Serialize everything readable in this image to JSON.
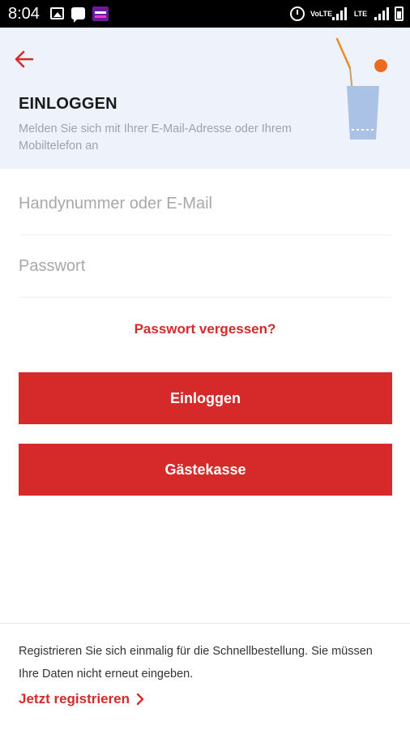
{
  "status_bar": {
    "time": "8:04",
    "lte_label_1": "VoLTE",
    "lte_label_2": "LTE",
    "icons": [
      "gallery-icon",
      "message-icon",
      "app-notification-icon",
      "alarm-icon",
      "signal-icon",
      "battery-icon"
    ]
  },
  "header": {
    "title": "EINLOGGEN",
    "subtitle": "Melden Sie sich mit Ihrer E-Mail-Adresse oder Ihrem Mobiltelefon an",
    "back_icon": "arrow-left-icon",
    "illustration": "drink-glass-illustration"
  },
  "form": {
    "phone_placeholder": "Handynummer oder E-Mail",
    "phone_value": "",
    "password_placeholder": "Passwort",
    "password_value": "",
    "forgot_label": "Passwort vergessen?",
    "login_label": "Einloggen",
    "guest_label": "Gästekasse"
  },
  "footer": {
    "text": "Registrieren Sie sich einmalig für die Schnellbestellung. Sie müssen Ihre Daten nicht erneut eingeben.",
    "register_label": "Jetzt registrieren",
    "register_icon": "chevron-right-icon"
  },
  "colors": {
    "accent": "#d62a2a",
    "header_bg": "#eef3fb",
    "status_bar": "#000000",
    "glass": "#a9c2e6",
    "straw": "#e8892b",
    "dot": "#ec6b1e"
  }
}
